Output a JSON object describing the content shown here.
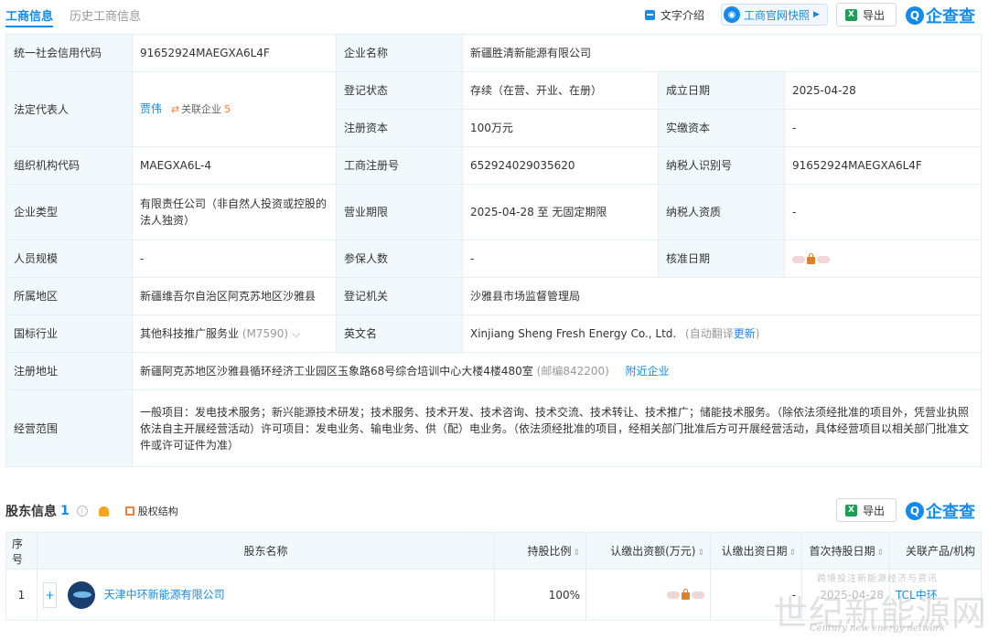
{
  "tabs": {
    "active": "工商信息",
    "inactive": "历史工商信息"
  },
  "toolbar": {
    "doc_label": "文字介绍",
    "snapshot_label": "工商官网快照",
    "export_label": "导出",
    "brand": "企查查"
  },
  "info": {
    "credit_code": {
      "key": "统一社会信用代码",
      "value": "91652924MAEGXA6L4F"
    },
    "company_name": {
      "key": "企业名称",
      "value": "新疆胜清新能源有限公司"
    },
    "legal_rep": {
      "key": "法定代表人",
      "name": "贾伟",
      "assoc_label": "关联企业",
      "assoc_count": "5"
    },
    "reg_status": {
      "key": "登记状态",
      "value": "存续（在营、开业、在册）"
    },
    "found_date": {
      "key": "成立日期",
      "value": "2025-04-28"
    },
    "reg_capital": {
      "key": "注册资本",
      "value": "100万元"
    },
    "paid_capital": {
      "key": "实缴资本",
      "value": "-"
    },
    "org_code": {
      "key": "组织机构代码",
      "value": "MAEGXA6L-4"
    },
    "biz_reg_no": {
      "key": "工商注册号",
      "value": "652924029035620"
    },
    "taxpayer_id": {
      "key": "纳税人识别号",
      "value": "91652924MAEGXA6L4F"
    },
    "company_type": {
      "key": "企业类型",
      "value": "有限责任公司（非自然人投资或控股的法人独资）"
    },
    "biz_term": {
      "key": "营业期限",
      "value": "2025-04-28 至 无固定期限"
    },
    "taxpayer_qual": {
      "key": "纳税人资质",
      "value": "-"
    },
    "staff_size": {
      "key": "人员规模",
      "value": "-"
    },
    "insured_count": {
      "key": "参保人数",
      "value": "-"
    },
    "approve_date": {
      "key": "核准日期"
    },
    "region": {
      "key": "所属地区",
      "value": "新疆维吾尔自治区阿克苏地区沙雅县"
    },
    "reg_authority": {
      "key": "登记机关",
      "value": "沙雅县市场监督管理局"
    },
    "industry": {
      "key": "国标行业",
      "value": "其他科技推广服务业",
      "code": "(M7590)"
    },
    "english_name": {
      "key": "英文名",
      "value": "Xinjiang Sheng Fresh Energy Co., Ltd.",
      "note_prefix": "(自动翻译",
      "note_link": "更新",
      "note_suffix": ")"
    },
    "reg_address": {
      "key": "注册地址",
      "value": "新疆阿克苏地区沙雅县循环经济工业园区玉象路68号综合培训中心大楼4楼480室",
      "postcode": "(邮编842200)",
      "nearby_link": "附近企业"
    },
    "biz_scope": {
      "key": "经营范围",
      "value": "一般项目：发电技术服务；新兴能源技术研发；技术服务、技术开发、技术咨询、技术交流、技术转让、技术推广；储能技术服务。（除依法须经批准的项目外，凭营业执照依法自主开展经营活动）许可项目：发电业务、输电业务、供（配）电业务。（依法须经批准的项目，经相关部门批准后方可开展经营活动，具体经营项目以相关部门批准文件或许可证件为准）"
    }
  },
  "shareholders": {
    "title": "股东信息",
    "count": "1",
    "equity_label": "股权结构",
    "export_label": "导出",
    "brand": "企查查",
    "columns": [
      "序号",
      "股东名称",
      "持股比例",
      "认缴出资额(万元)",
      "认缴出资日期",
      "首次持股日期",
      "关联产品/机构"
    ],
    "rows": [
      {
        "index": "1",
        "name": "天津中环新能源有限公司",
        "ratio": "100%",
        "sub_date": "-",
        "first_date": "2025-04-28",
        "product": "TCL中环"
      }
    ]
  },
  "watermark": {
    "top": "跨境投注新能源经济与资讯",
    "main": "世纪新能源网",
    "sub": "Century new energy network"
  }
}
